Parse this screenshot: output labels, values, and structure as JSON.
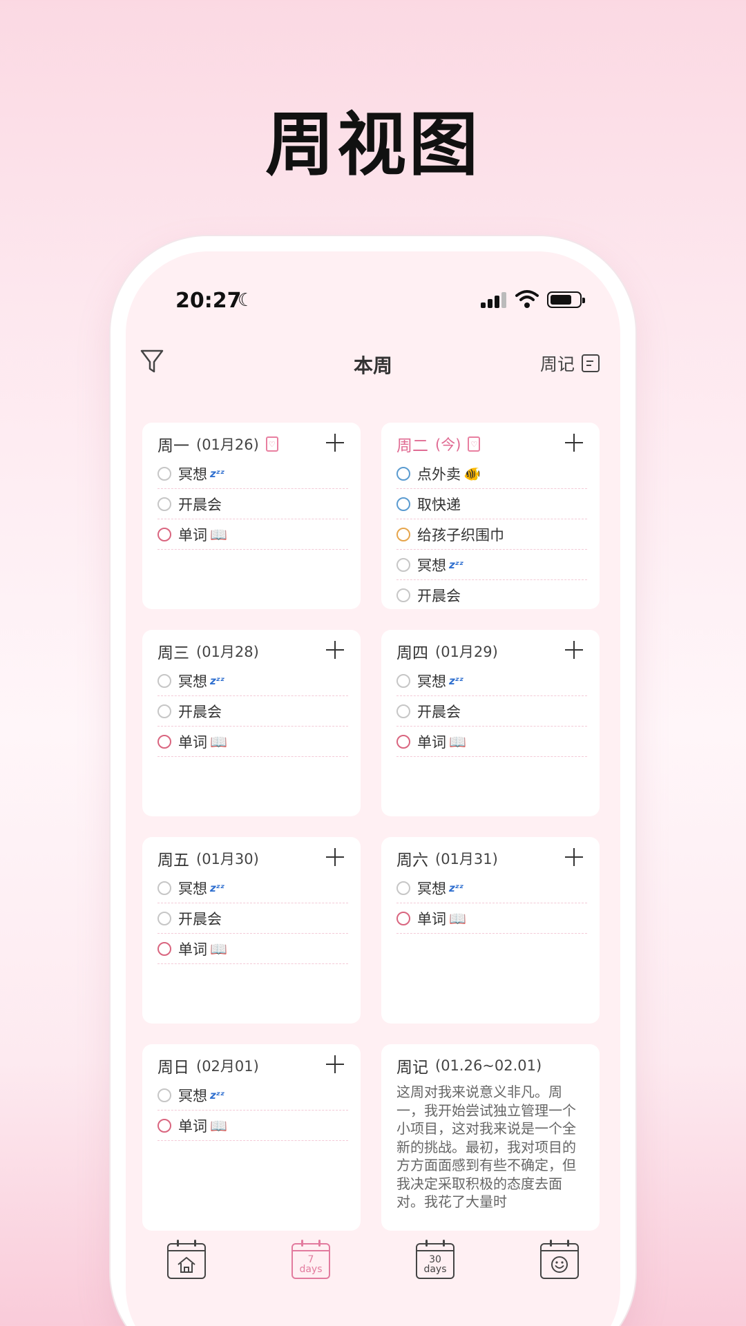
{
  "hero": {
    "title": "周视图"
  },
  "status_bar": {
    "time": "20:27"
  },
  "header": {
    "title": "本周",
    "journal_label": "周记"
  },
  "days": [
    {
      "name": "周一",
      "date": "(01月26)",
      "today": false,
      "tasks": [
        {
          "label": "冥想",
          "badge": "zzz",
          "status": "gray"
        },
        {
          "label": "开晨会",
          "status": "gray"
        },
        {
          "label": "单词",
          "badge": "📖",
          "status": "red"
        }
      ]
    },
    {
      "name": "周二",
      "date": "(今)",
      "today": true,
      "tasks": [
        {
          "label": "点外卖",
          "badge": "🐠",
          "status": "blue"
        },
        {
          "label": "取快递",
          "status": "blue"
        },
        {
          "label": "给孩子织围巾",
          "status": "orange"
        },
        {
          "label": "冥想",
          "badge": "zzz",
          "status": "gray"
        },
        {
          "label": "开晨会",
          "status": "gray"
        }
      ]
    },
    {
      "name": "周三",
      "date": "(01月28)",
      "today": false,
      "tasks": [
        {
          "label": "冥想",
          "badge": "zzz",
          "status": "gray"
        },
        {
          "label": "开晨会",
          "status": "gray"
        },
        {
          "label": "单词",
          "badge": "📖",
          "status": "red"
        }
      ]
    },
    {
      "name": "周四",
      "date": "(01月29)",
      "today": false,
      "tasks": [
        {
          "label": "冥想",
          "badge": "zzz",
          "status": "gray"
        },
        {
          "label": "开晨会",
          "status": "gray"
        },
        {
          "label": "单词",
          "badge": "📖",
          "status": "red"
        }
      ]
    },
    {
      "name": "周五",
      "date": "(01月30)",
      "today": false,
      "tasks": [
        {
          "label": "冥想",
          "badge": "zzz",
          "status": "gray"
        },
        {
          "label": "开晨会",
          "status": "gray"
        },
        {
          "label": "单词",
          "badge": "📖",
          "status": "red"
        }
      ]
    },
    {
      "name": "周六",
      "date": "(01月31)",
      "today": false,
      "tasks": [
        {
          "label": "冥想",
          "badge": "zzz",
          "status": "gray"
        },
        {
          "label": "单词",
          "badge": "📖",
          "status": "red"
        }
      ]
    },
    {
      "name": "周日",
      "date": "(02月01)",
      "today": false,
      "tasks": [
        {
          "label": "冥想",
          "badge": "zzz",
          "status": "gray"
        },
        {
          "label": "单词",
          "badge": "📖",
          "status": "red"
        }
      ]
    }
  ],
  "journal": {
    "title": "周记",
    "range": "(01.26~02.01)",
    "text": "这周对我来说意义非凡。周一，我开始尝试独立管理一个小项目，这对我来说是一个全新的挑战。最初，我对项目的方方面面感到有些不确定，但我决定采取积极的态度去面对。我花了大量时"
  },
  "tabbar": {
    "tabs": [
      {
        "name": "home",
        "top": "",
        "bottom": ""
      },
      {
        "name": "week",
        "top": "7",
        "bottom": "days",
        "active": true
      },
      {
        "name": "month",
        "top": "30",
        "bottom": "days"
      },
      {
        "name": "mood",
        "top": "",
        "bottom": ""
      }
    ]
  },
  "colors": {
    "accent": "#e06b93",
    "task_red": "#d9657f",
    "task_blue": "#5a9bd0",
    "task_orange": "#e6a54b"
  }
}
